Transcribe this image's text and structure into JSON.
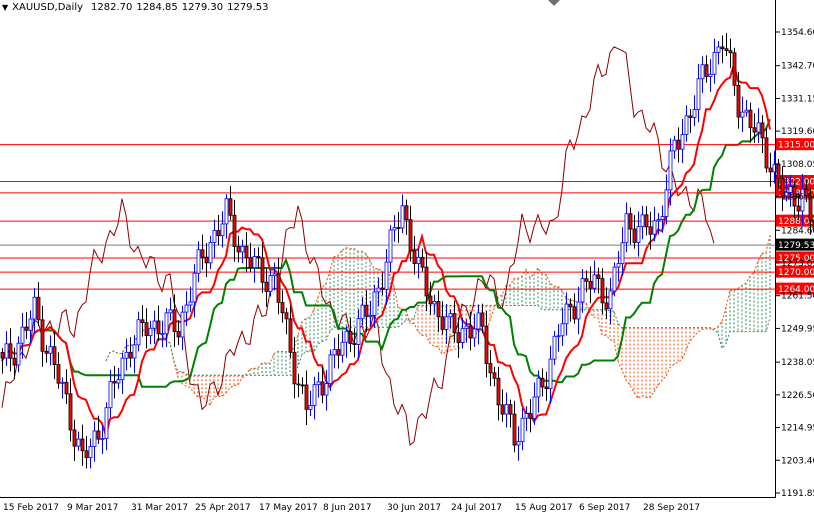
{
  "header": {
    "symbol": "XAUUSD,Daily",
    "open": "1282.70",
    "high": "1284.85",
    "low": "1279.30",
    "close": "1279.53"
  },
  "chart_data": {
    "type": "candlestick",
    "title": "XAUUSD,Daily",
    "indicator": "Ichimoku Kinko Hyo (9, 26, 52)",
    "ylim": [
      1191.85,
      1354.6
    ],
    "y_ticks": [
      "1354.60",
      "1342.70",
      "1331.15",
      "1319.60",
      "1308.05",
      "1296.50",
      "1284.60",
      "1273.05",
      "1261.50",
      "1249.95",
      "1238.05",
      "1226.50",
      "1214.95",
      "1203.40",
      "1191.85"
    ],
    "x_ticks": [
      "15 Feb 2017",
      "9 Mar 2017",
      "31 Mar 2017",
      "25 Apr 2017",
      "17 May 2017",
      "8 Jun 2017",
      "30 Jun 2017",
      "24 Jul 2017",
      "15 Aug 2017",
      "6 Sep 2017",
      "28 Sep 2017"
    ],
    "bars_per_x_tick": 16,
    "close_path_every_4_bars": [
      1237,
      1245,
      1256,
      1240,
      1224,
      1203,
      1213,
      1230,
      1245,
      1250,
      1252,
      1250,
      1268,
      1281,
      1290,
      1277,
      1270,
      1267,
      1242,
      1221,
      1232,
      1242,
      1250,
      1256,
      1274,
      1293,
      1270,
      1258,
      1249,
      1250,
      1249,
      1224,
      1213,
      1220,
      1235,
      1252,
      1262,
      1267,
      1260,
      1288,
      1284,
      1288,
      1313,
      1327,
      1341,
      1352,
      1330,
      1320,
      1309,
      1295,
      1298,
      1280
    ],
    "horizontal_levels": [
      {
        "price": 1315.0,
        "label": "1315.00"
      },
      {
        "price": 1302.0,
        "label": "1302.00"
      },
      {
        "price": 1298.0,
        "label": "1298.00"
      },
      {
        "price": 1288.0,
        "label": "1288.00"
      },
      {
        "price": 1275.0,
        "label": "1275.00"
      },
      {
        "price": 1270.0,
        "label": "1270.00"
      },
      {
        "price": 1264.0,
        "label": "1264.00"
      }
    ],
    "current_price": {
      "price": 1279.53,
      "label": "1279.53"
    },
    "colors": {
      "bull": "#0000ff",
      "bear": "#ff0000",
      "tenkan": "#ff0000",
      "kijun": "#008000",
      "chikou": "#8b0000",
      "cloud_up": "#2e8b57",
      "cloud_down": "#ff4500",
      "level": "#ff0000",
      "current": "#708090"
    }
  }
}
